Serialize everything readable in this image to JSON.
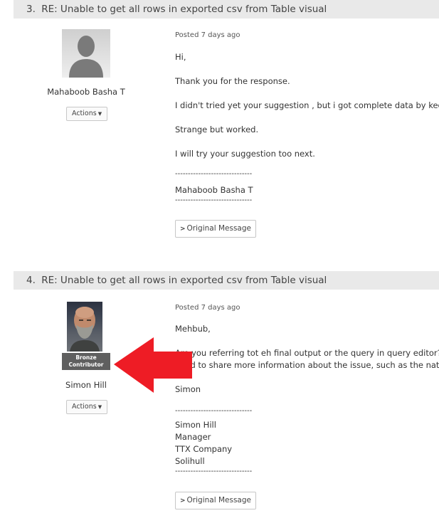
{
  "posts": [
    {
      "number": "3.",
      "title": "RE: Unable to get all rows in exported csv from Table visual",
      "author": "Mahaboob Basha T",
      "actions_label": "Actions",
      "posted": "Posted 7 days ago",
      "body": [
        "Hi,",
        "Thank you for the response.",
        "I didn't tried yet your suggestion , but i got complete data by keepin",
        "Strange but worked.",
        "I will try your suggestion too next.",
        "------------------------------",
        "Mahaboob Basha T",
        "------------------------------"
      ],
      "original_message_label": "Original Message"
    },
    {
      "number": "4.",
      "title": "RE: Unable to get all rows in exported csv from Table visual",
      "author": "Simon Hill",
      "badge": [
        "Bronze",
        "Contributor"
      ],
      "actions_label": "Actions",
      "posted": "Posted 7 days ago",
      "body": [
        "Mehbub,",
        "Are you referring tot eh final output or the query in query editor? If",
        "need to share more information about the issue, such as the natur",
        "Simon",
        "------------------------------",
        "Simon Hill",
        "Manager",
        "TTX Company",
        "Solihull",
        "------------------------------"
      ],
      "original_message_label": "Original Message"
    }
  ],
  "colors": {
    "header_bg": "#e9e9e9",
    "badge_bg": "#5f5f5f",
    "arrow": "#ee1c25"
  },
  "icons": [
    "user-silhouette-icon",
    "caret-down-icon",
    "chevron-right-icon",
    "red-left-arrow-icon"
  ]
}
